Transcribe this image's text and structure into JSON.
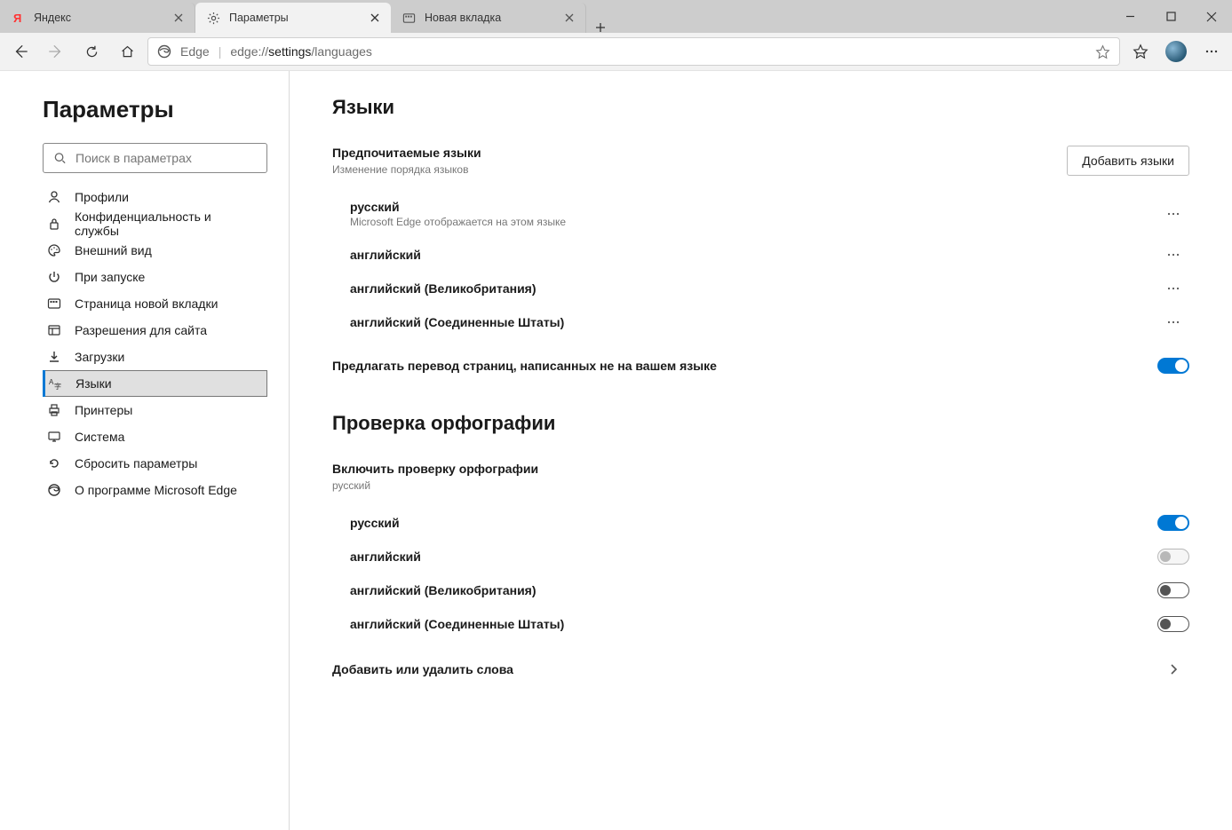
{
  "tabs": [
    {
      "label": "Яндекс",
      "icon": "ya"
    },
    {
      "label": "Параметры",
      "icon": "gear"
    },
    {
      "label": "Новая вкладка",
      "icon": "ntp"
    }
  ],
  "addr": {
    "site_label": "Edge",
    "url_pre": "edge://",
    "url_emph": "settings",
    "url_post": "/languages"
  },
  "sidebar": {
    "title": "Параметры",
    "search_placeholder": "Поиск в параметрах",
    "items": [
      {
        "label": "Профили"
      },
      {
        "label": "Конфиденциальность и службы"
      },
      {
        "label": "Внешний вид"
      },
      {
        "label": "При запуске"
      },
      {
        "label": "Страница новой вкладки"
      },
      {
        "label": "Разрешения для сайта"
      },
      {
        "label": "Загрузки"
      },
      {
        "label": "Языки"
      },
      {
        "label": "Принтеры"
      },
      {
        "label": "Система"
      },
      {
        "label": "Сбросить параметры"
      },
      {
        "label": "О программе Microsoft Edge"
      }
    ]
  },
  "main": {
    "lang_section_title": "Языки",
    "pref_title": "Предпочитаемые языки",
    "pref_sub": "Изменение порядка языков",
    "add_btn": "Добавить языки",
    "langs": [
      {
        "name": "русский",
        "sub": "Microsoft Edge отображается на этом языке"
      },
      {
        "name": "английский",
        "sub": ""
      },
      {
        "name": "английский (Великобритания)",
        "sub": ""
      },
      {
        "name": "английский (Соединенные Штаты)",
        "sub": ""
      }
    ],
    "translate_label": "Предлагать перевод страниц, написанных не на вашем языке",
    "translate_on": true,
    "spell_section_title": "Проверка орфографии",
    "spell_enable_title": "Включить проверку орфографии",
    "spell_enable_sub": "русский",
    "spell_langs": [
      {
        "name": "русский",
        "state": "on"
      },
      {
        "name": "английский",
        "state": "disabled"
      },
      {
        "name": "английский (Великобритания)",
        "state": "off"
      },
      {
        "name": "английский (Соединенные Штаты)",
        "state": "off"
      }
    ],
    "manage_words": "Добавить или удалить слова"
  }
}
